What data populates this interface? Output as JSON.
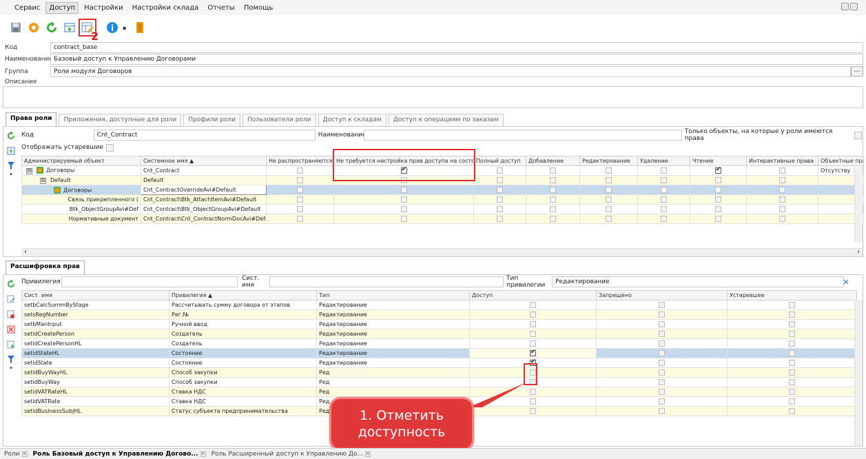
{
  "menu": [
    "Сервис",
    "Доступ",
    "Настройки",
    "Настройки склада",
    "Отчеты",
    "Помощь"
  ],
  "menu_active": 1,
  "toolbar": {
    "callout_num": "2"
  },
  "form": {
    "code_label": "Код",
    "code_value": "contract_base",
    "name_label": "Наименование",
    "name_value": "Базовый доступ к Управлению Договорами",
    "group_label": "Группа",
    "group_value": "Роли модуля Договоров",
    "desc_label": "Описание",
    "dots": "..."
  },
  "tabs": [
    "Права роли",
    "Приложения, доступные для роли",
    "Профили роли",
    "Пользователи роли",
    "Доступ к складам",
    "Доступ к операциям по заказам"
  ],
  "upper": {
    "code_label": "Код",
    "code_value": "Cnt_Contract",
    "name_label": "Наименование",
    "name_value": "",
    "only_label": "Только объекты, на которые у роли имеются права",
    "obsolete_label": "Отображать устаревшие",
    "columns": [
      "Администрируемый объект",
      "Системное имя ▲",
      "Не распространяются...",
      "Не требуется настройка прав доступа на состо...",
      "Полный доступ",
      "Добавление",
      "Редактирование",
      "Удаление",
      "Чтение",
      "Интерактивные права",
      "Объектные пра"
    ],
    "rows": [
      {
        "obj": "Договоры",
        "sys": "Cnt_Contract",
        "level": 0,
        "tree": "⊟",
        "icon": true,
        "cls": "",
        "cb": [
          false,
          true,
          false,
          false,
          false,
          false,
          true,
          false
        ],
        "last": "Отсутству"
      },
      {
        "obj": "Default",
        "sys": "Default",
        "level": 1,
        "tree": "⊟",
        "icon": false,
        "cls": "yel",
        "cb": [
          false,
          false,
          false,
          false,
          false,
          false,
          false,
          false
        ],
        "last": ""
      },
      {
        "obj": "Договоры",
        "sys": "Cnt_ContractOverrideAvi#Default",
        "level": 2,
        "tree": "",
        "icon": true,
        "cls": "sel",
        "cb": [
          false,
          false,
          false,
          false,
          false,
          false,
          false,
          false
        ],
        "last": ""
      },
      {
        "obj": "Связь прикрепленного (",
        "sys": "Cnt_Contract\\Btk_AttachItemAvi#Default",
        "level": 3,
        "tree": "",
        "icon": false,
        "cls": "yel",
        "cb": [
          false,
          false,
          false,
          false,
          false,
          false,
          false,
          false
        ],
        "last": ""
      },
      {
        "obj": "Btk_ObjectGroupAvi#Def",
        "sys": "Cnt_Contract\\Btk_ObjectGroupAvi#Default",
        "level": 3,
        "tree": "",
        "icon": false,
        "cls": "",
        "cb": [
          false,
          false,
          false,
          false,
          false,
          false,
          false,
          false
        ],
        "last": ""
      },
      {
        "obj": "Нормативные документ",
        "sys": "Cnt_Contract\\Cnt_ContractNormDocAvi#Defa",
        "level": 3,
        "tree": "",
        "icon": false,
        "cls": "yel",
        "cb": [
          false,
          false,
          false,
          false,
          false,
          false,
          false,
          false
        ],
        "last": ""
      }
    ]
  },
  "lower": {
    "tab": "Расшифровка прав",
    "priv_label": "Привилегия",
    "sys_label": "Сист. имя",
    "type_label": "Тип привилегии",
    "type_value": "Редактирование",
    "columns": [
      "Сист. имя",
      "Привилегия ▲",
      "Тип",
      "Доступ",
      "Запрещено",
      "Устаревшее"
    ],
    "rows": [
      {
        "sys": "setbCalcSummByStage",
        "priv": "Рассчитывать сумму договора от этапов",
        "type": "Редактирование",
        "cls": "",
        "cb": [
          false,
          false,
          false
        ]
      },
      {
        "sys": "setsRegNumber",
        "priv": "Рег.№",
        "type": "Редактирование",
        "cls": "yel",
        "cb": [
          false,
          false,
          false
        ]
      },
      {
        "sys": "setbManInput",
        "priv": "Ручной ввод",
        "type": "Редактирование",
        "cls": "",
        "cb": [
          false,
          false,
          false
        ]
      },
      {
        "sys": "setidCreatePerson",
        "priv": "Создатель",
        "type": "Редактирование",
        "cls": "yel",
        "cb": [
          false,
          false,
          false
        ]
      },
      {
        "sys": "setidCreatePersonHL",
        "priv": "Создатель",
        "type": "Редактирование",
        "cls": "",
        "cb": [
          false,
          false,
          false
        ]
      },
      {
        "sys": "setidStateHL",
        "priv": "Состояние",
        "type": "Редактирование",
        "cls": "sel",
        "cb": [
          true,
          false,
          false
        ]
      },
      {
        "sys": "setidState",
        "priv": "Состояние",
        "type": "Редактирование",
        "cls": "",
        "cb": [
          true,
          false,
          false
        ]
      },
      {
        "sys": "setidBuyWayHL",
        "priv": "Способ закупки",
        "type": "Ред",
        "cls": "yel",
        "cb": [
          false,
          false,
          false
        ]
      },
      {
        "sys": "setidBuyWay",
        "priv": "Способ закупки",
        "type": "Ред",
        "cls": "",
        "cb": [
          false,
          false,
          false
        ]
      },
      {
        "sys": "setidVATRateHL",
        "priv": "Ставка НДС",
        "type": "Ред",
        "cls": "yel",
        "cb": [
          false,
          false,
          false
        ]
      },
      {
        "sys": "setidVATRate",
        "priv": "Ставка НДС",
        "type": "Ред",
        "cls": "",
        "cb": [
          false,
          false,
          false
        ]
      },
      {
        "sys": "setidBusinessSubjHL",
        "priv": "Статус субъекта предпринимательства",
        "type": "Ред",
        "cls": "yel",
        "cb": [
          false,
          false,
          false
        ]
      }
    ]
  },
  "callout": "1. Отметить доступность",
  "bottom_tabs": [
    "Роли",
    "Роль Базовый доступ к Управлению Догово...",
    "Роль Расширенный доступ к Управлению До..."
  ],
  "bottom_active": 1
}
